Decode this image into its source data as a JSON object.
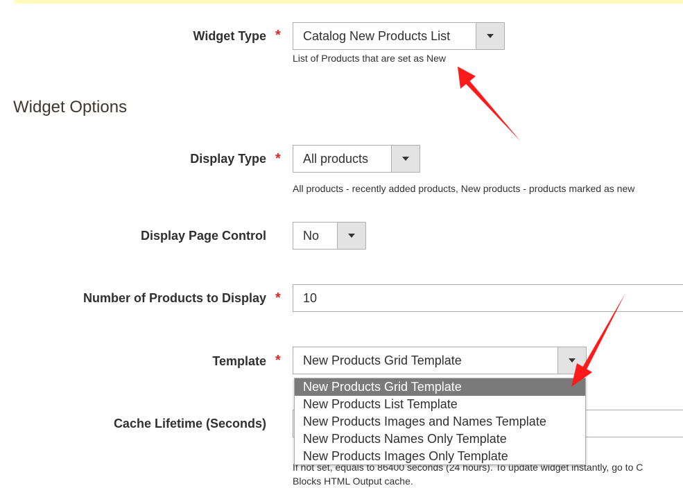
{
  "form": {
    "widget_type": {
      "label": "Widget Type",
      "required_mark": "*",
      "value": "Catalog New Products List",
      "note": "List of Products that are set as New"
    },
    "section_title": "Widget Options",
    "display_type": {
      "label": "Display Type",
      "required_mark": "*",
      "value": "All products",
      "note": "All products - recently added products, New products - products marked as new"
    },
    "display_page_control": {
      "label": "Display Page Control",
      "value": "No"
    },
    "products_count": {
      "label": "Number of Products to Display",
      "required_mark": "*",
      "value": "10"
    },
    "template": {
      "label": "Template",
      "required_mark": "*",
      "value": "New Products Grid Template",
      "options": [
        "New Products Grid Template",
        "New Products List Template",
        "New Products Images and Names Template",
        "New Products Names Only Template",
        "New Products Images Only Template"
      ]
    },
    "cache_lifetime": {
      "label": "Cache Lifetime (Seconds)",
      "note_line1": "If not set, equals to 86400 seconds (24 hours). To update widget instantly, go to C",
      "note_line2": "Blocks HTML Output cache."
    }
  },
  "colors": {
    "annotation_arrow": "#ff1a1a",
    "required": "#e22626",
    "top_band": "#fffbbb",
    "selected_option": "#7a7a7a"
  }
}
